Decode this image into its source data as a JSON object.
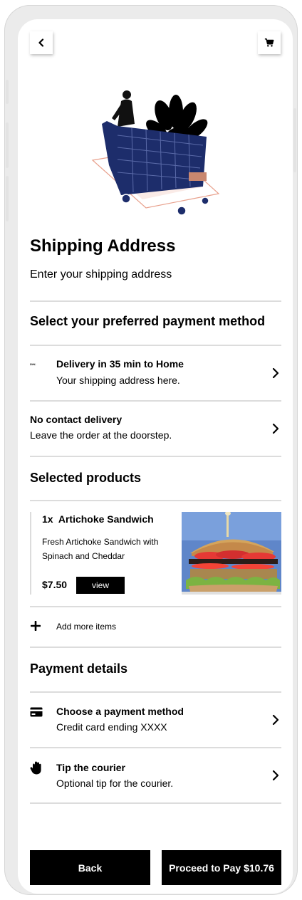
{
  "header": {
    "back_icon": "chevron-left-icon",
    "cart_icon": "cart-icon"
  },
  "shipping": {
    "title": "Shipping Address",
    "subtitle": "Enter your shipping address"
  },
  "payment_method_section": {
    "heading": "Select your preferred payment method"
  },
  "delivery_option": {
    "title": "Delivery in 35 min to Home",
    "subtitle": "Your shipping address here.",
    "logo_text": "DHL"
  },
  "contact_option": {
    "title": "No contact delivery",
    "subtitle": "Leave the order at the doorstep."
  },
  "products_section": {
    "heading": "Selected products",
    "items": [
      {
        "quantity": "1x",
        "name": "Artichoke Sandwich",
        "description_line1": "Fresh Artichoke Sandwich with",
        "description_line2": "Spinach and Cheddar",
        "price": "$7.50",
        "view_label": "view"
      }
    ],
    "add_more_label": "Add more items"
  },
  "payment_details": {
    "heading": "Payment details",
    "method_title": "Choose a payment method",
    "method_subtitle": "Credit card ending XXXX",
    "tip_title": "Tip the courier",
    "tip_subtitle": "Optional tip for the courier."
  },
  "footer": {
    "back_label": "Back",
    "proceed_label": "Proceed to Pay $10.76"
  },
  "colors": {
    "primary": "#000000",
    "divider": "#dcdcdc",
    "cart_blue": "#1d2d6b",
    "accent_salmon": "#e8a08c"
  }
}
